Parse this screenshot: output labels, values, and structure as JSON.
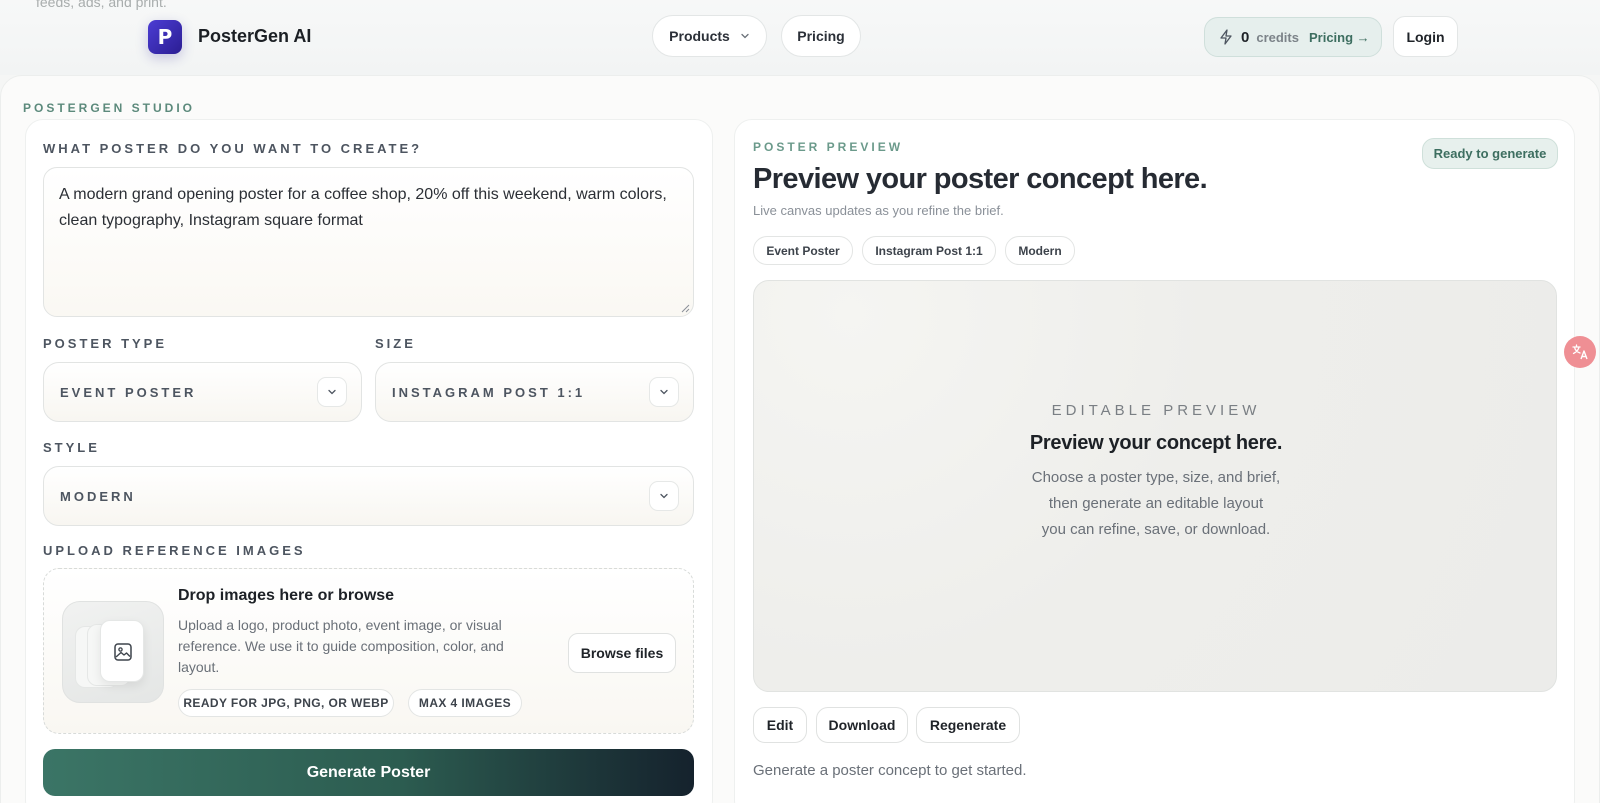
{
  "background": {
    "cut_text": "feeds, ads, and print."
  },
  "header": {
    "brand": "PosterGen AI",
    "logo_letter": "P",
    "nav": {
      "products": "Products",
      "pricing": "Pricing"
    },
    "credits": {
      "count": "0",
      "label": "credits",
      "link": "Pricing →"
    },
    "login": "Login"
  },
  "studio": {
    "label": "POSTERGEN STUDIO",
    "prompt": {
      "label": "WHAT POSTER DO YOU WANT TO CREATE?",
      "value": "A modern grand opening poster for a coffee shop, 20% off this weekend, warm colors, clean typography, Instagram square format"
    },
    "poster_type": {
      "label": "POSTER TYPE",
      "value": "EVENT POSTER"
    },
    "size": {
      "label": "SIZE",
      "value": "INSTAGRAM POST 1:1"
    },
    "style": {
      "label": "STYLE",
      "value": "MODERN"
    },
    "upload": {
      "label": "UPLOAD REFERENCE IMAGES",
      "title": "Drop images here or browse",
      "description": "Upload a logo, product photo, event image, or visual reference. We use it to guide composition, color, and layout.",
      "chip_formats": "READY FOR JPG, PNG, OR WEBP",
      "chip_max": "MAX 4 IMAGES",
      "browse": "Browse files"
    },
    "generate": "Generate Poster"
  },
  "preview": {
    "label": "POSTER PREVIEW",
    "title": "Preview your poster concept here.",
    "subtitle": "Live canvas updates as you refine the brief.",
    "status": "Ready to generate",
    "tags": [
      "Event Poster",
      "Instagram Post 1:1",
      "Modern"
    ],
    "canvas": {
      "label": "EDITABLE PREVIEW",
      "title": "Preview your concept here.",
      "lines": [
        "Choose a poster type, size, and brief,",
        "then generate an editable layout",
        "you can refine, save, or download."
      ]
    },
    "actions": {
      "edit": "Edit",
      "download": "Download",
      "regenerate": "Regenerate"
    },
    "hint": "Generate a poster concept to get started."
  },
  "colors": {
    "accent": "#3b7566",
    "brand": "#4c3dd4",
    "translate": "#ef8f94"
  }
}
